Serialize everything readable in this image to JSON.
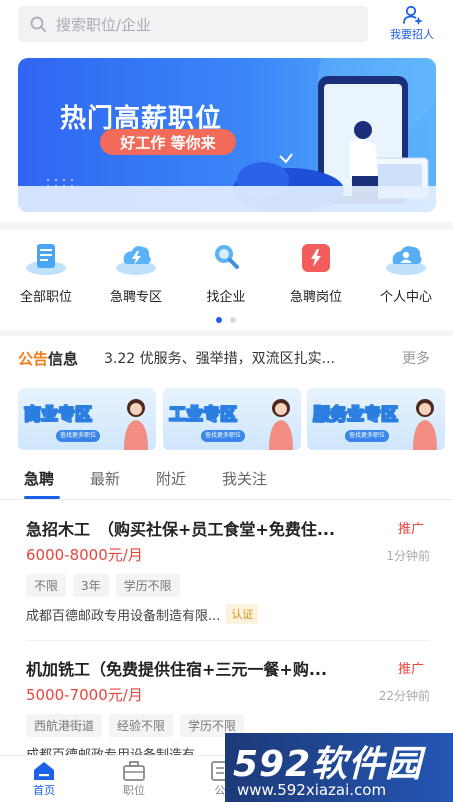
{
  "search": {
    "placeholder": "搜索职位/企业"
  },
  "header": {
    "recruit_label": "我要招人"
  },
  "banner": {
    "title": "热门高薪职位",
    "pill": "好工作 等你来"
  },
  "quick_nav": [
    {
      "label": "全部职位",
      "icon": "list-icon"
    },
    {
      "label": "急聘专区",
      "icon": "lightning-cloud-icon"
    },
    {
      "label": "找企业",
      "icon": "magnifier-icon"
    },
    {
      "label": "急聘岗位",
      "icon": "urgent-card-icon"
    },
    {
      "label": "个人中心",
      "icon": "user-cloud-icon"
    }
  ],
  "notice": {
    "logo_a": "公告",
    "logo_b": "信息",
    "text": "3.22 优服务、强举措，双流区扎实...",
    "more": "更多"
  },
  "zones": [
    {
      "title": "商业专区",
      "sub": "查找更多职位"
    },
    {
      "title": "工业专区",
      "sub": "查找更多职位"
    },
    {
      "title": "服务业专区",
      "sub": "查找更多职位"
    }
  ],
  "tabs": [
    "急聘",
    "最新",
    "附近",
    "我关注"
  ],
  "jobs": [
    {
      "title": "急招木工　（购买社保+员工食堂+免费住...",
      "tag": "推广",
      "salary": "6000-8000元/月",
      "time": "1分钟前",
      "chips": [
        "不限",
        "3年",
        "学历不限"
      ],
      "company": "成都百德邮政专用设备制造有限...",
      "verify": "认证"
    },
    {
      "title": "机加铣工（免费提供住宿+三元一餐+购...",
      "tag": "推广",
      "salary": "5000-7000元/月",
      "time": "22分钟前",
      "chips": [
        "西航港街道",
        "经验不限",
        "学历不限"
      ],
      "company": "成都百德邮政专用设备制造有"
    }
  ],
  "tabbar": [
    {
      "label": "首页",
      "icon": "home-icon"
    },
    {
      "label": "职位",
      "icon": "briefcase-icon"
    },
    {
      "label": "公",
      "icon": "document-icon"
    }
  ],
  "watermark": {
    "brand": "592软件园",
    "url": "www.592xiazai.com"
  },
  "colors": {
    "primary": "#1c5fe8",
    "salary": "#e8453c",
    "banner": "#3b86f7"
  }
}
